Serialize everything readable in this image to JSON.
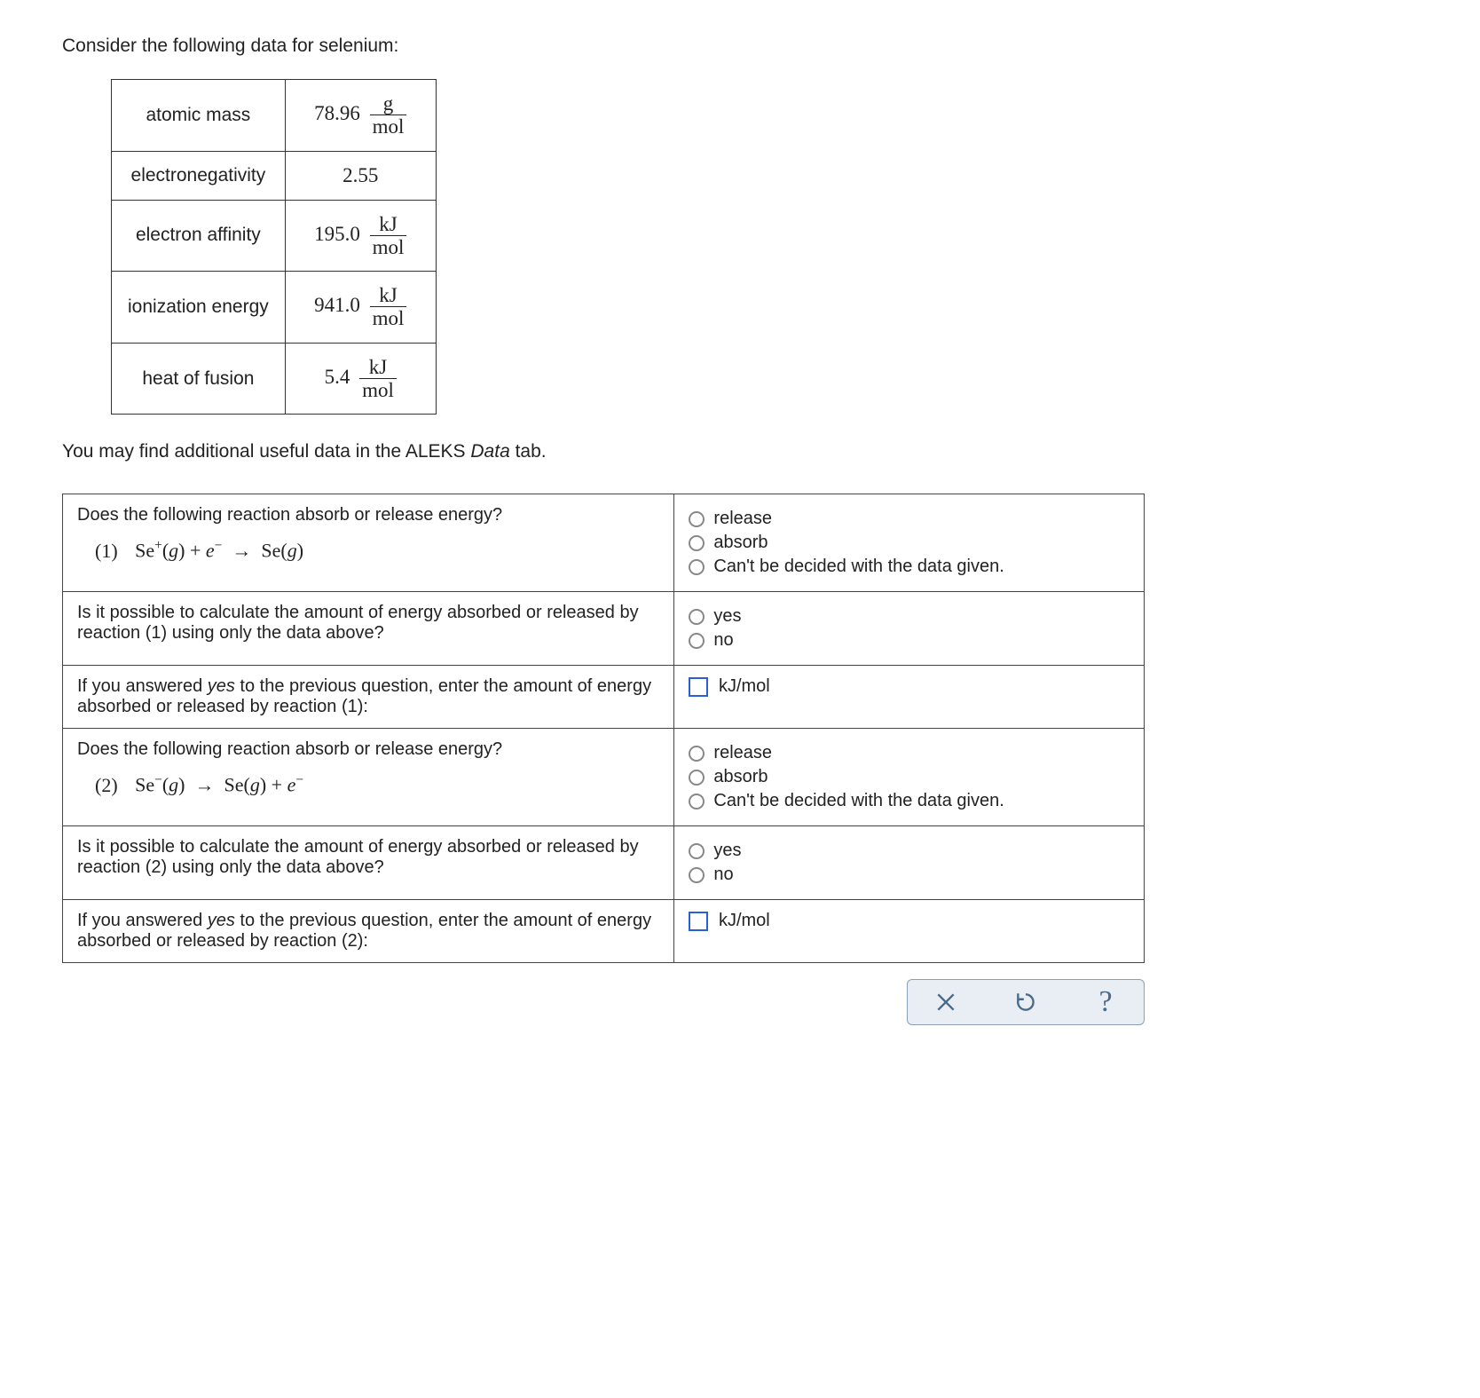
{
  "intro": "Consider the following data for selenium:",
  "dataTable": {
    "rows": [
      {
        "label": "atomic mass",
        "value": "78.96",
        "frac_num": "g",
        "frac_den": "mol"
      },
      {
        "label": "electronegativity",
        "value": "2.55",
        "frac_num": "",
        "frac_den": ""
      },
      {
        "label": "electron affinity",
        "value": "195.0",
        "frac_num": "kJ",
        "frac_den": "mol"
      },
      {
        "label": "ionization energy",
        "value": "941.0",
        "frac_num": "kJ",
        "frac_den": "mol"
      },
      {
        "label": "heat of fusion",
        "value": "5.4",
        "frac_num": "kJ",
        "frac_den": "mol"
      }
    ]
  },
  "subNote": {
    "prefix": "You may find additional useful data in the ALEKS ",
    "italic": "Data",
    "suffix": " tab."
  },
  "q1": {
    "prompt": "Does the following reaction absorb or release energy?",
    "eqLabel": "(1)",
    "opts": {
      "a": "release",
      "b": "absorb",
      "c": "Can't be decided with the data given."
    }
  },
  "q2": {
    "prompt": "Is it possible to calculate the amount of energy absorbed or released by reaction (1) using only the data above?",
    "opts": {
      "a": "yes",
      "b": "no"
    }
  },
  "q3": {
    "prefix": "If you answered ",
    "yes": "yes",
    "suffix": " to the previous question, enter the amount of energy absorbed or released by reaction (1):",
    "unit": "kJ/mol"
  },
  "q4": {
    "prompt": "Does the following reaction absorb or release energy?",
    "eqLabel": "(2)",
    "opts": {
      "a": "release",
      "b": "absorb",
      "c": "Can't be decided with the data given."
    }
  },
  "q5": {
    "prompt": "Is it possible to calculate the amount of energy absorbed or released by reaction (2) using only the data above?",
    "opts": {
      "a": "yes",
      "b": "no"
    }
  },
  "q6": {
    "prefix": "If you answered ",
    "yes": "yes",
    "suffix": " to the previous question, enter the amount of energy absorbed or released by reaction (2):",
    "unit": "kJ/mol"
  }
}
